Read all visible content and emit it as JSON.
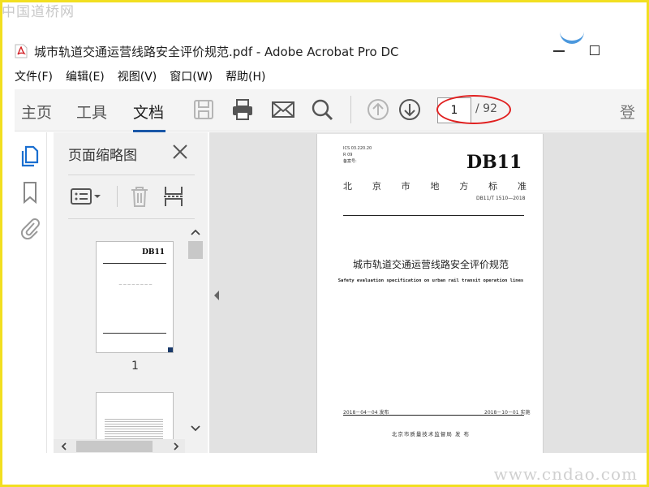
{
  "watermarks": {
    "top": "中国道桥网",
    "bottom": "www.cndao.com"
  },
  "window": {
    "title": "城市轨道交通运营线路安全评价规范.pdf - Adobe Acrobat Pro DC"
  },
  "menu": [
    "文件(F)",
    "编辑(E)",
    "视图(V)",
    "窗口(W)",
    "帮助(H)"
  ],
  "toolbar": {
    "tabs": [
      "主页",
      "工具",
      "文档"
    ],
    "active_tab": "文档",
    "icons": [
      "save-icon",
      "print-icon",
      "mail-icon",
      "search-icon",
      "page-up-icon",
      "page-down-icon"
    ],
    "current_page": "1",
    "total_pages": "/ 92",
    "login": "登"
  },
  "sidebar": {
    "icons": [
      "page-thumbnails-icon",
      "bookmark-icon",
      "attachment-icon"
    ]
  },
  "thumbnail_panel": {
    "title": "页面缩略图",
    "page_label": "1"
  },
  "document_page": {
    "ics": "ICS 03.220.20",
    "ics2": "R 09",
    "record_no": "备案号:",
    "std_name": "DB11",
    "org_chars": [
      "北",
      "京",
      "市",
      "地",
      "方",
      "标",
      "准"
    ],
    "code": "DB11/T 1510—2018",
    "title_cn": "城市轨道交通运营线路安全评价规范",
    "title_en": "Safety evaluation specification on urban rail transit operation lines",
    "publish_date": "2018－04－04 发布",
    "effective_date": "2018－10－01 实施",
    "issuer": "北京市质量技术监督局    发 布"
  },
  "colors": {
    "accent": "#1a57a8",
    "highlight": "#e02020",
    "frame": "#f2df20"
  }
}
